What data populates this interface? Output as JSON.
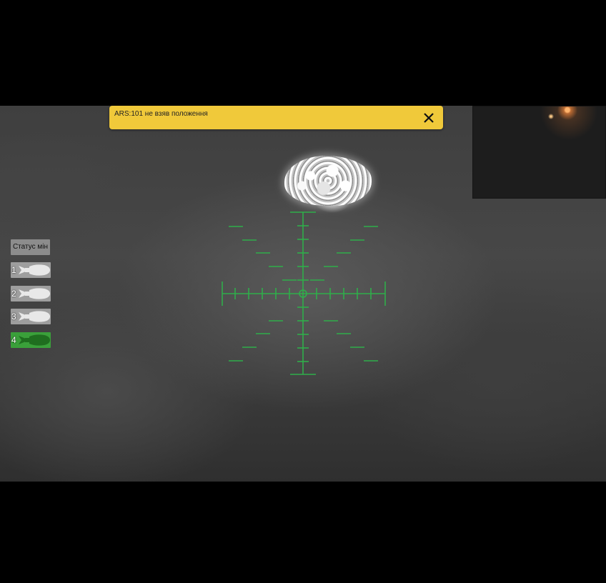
{
  "alert": {
    "message": "ARS:101 не взяв положення",
    "close_icon": "close-icon",
    "background_color": "#f0c93a"
  },
  "mine_status": {
    "title": "Статус мін",
    "slots": [
      {
        "number": "1",
        "state": "inactive",
        "color": "#9e9e9e"
      },
      {
        "number": "2",
        "state": "inactive",
        "color": "#9e9e9e"
      },
      {
        "number": "3",
        "state": "inactive",
        "color": "#9e9e9e"
      },
      {
        "number": "4",
        "state": "active",
        "color": "#3aa03a"
      }
    ]
  },
  "reticle": {
    "color": "#2fae4a",
    "icon": "crosshair-icon"
  }
}
